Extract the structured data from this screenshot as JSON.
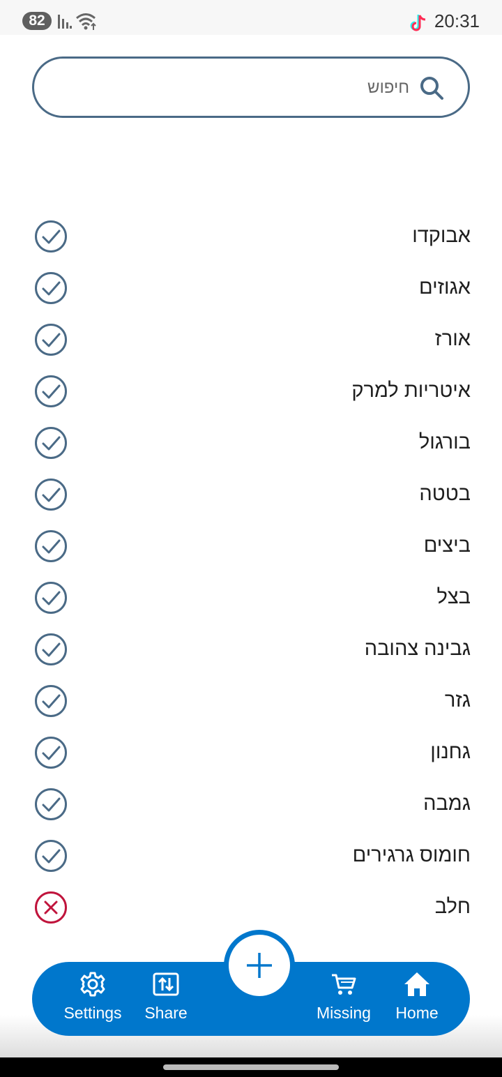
{
  "status_bar": {
    "battery": "82",
    "time": "20:31"
  },
  "search": {
    "placeholder": "חיפוש",
    "value": ""
  },
  "items": [
    {
      "label": "אבוקדו",
      "status": "check"
    },
    {
      "label": "אגוזים",
      "status": "check"
    },
    {
      "label": "אורז",
      "status": "check"
    },
    {
      "label": "איטריות למרק",
      "status": "check"
    },
    {
      "label": "בורגול",
      "status": "check"
    },
    {
      "label": "בטטה",
      "status": "check"
    },
    {
      "label": "ביצים",
      "status": "check"
    },
    {
      "label": "בצל",
      "status": "check"
    },
    {
      "label": "גבינה צהובה",
      "status": "check"
    },
    {
      "label": "גזר",
      "status": "check"
    },
    {
      "label": "גחנון",
      "status": "check"
    },
    {
      "label": "גמבה",
      "status": "check"
    },
    {
      "label": "חומוס גרגירים",
      "status": "check"
    },
    {
      "label": "חלב",
      "status": "cross"
    }
  ],
  "bottom_nav": {
    "settings_label": "Settings",
    "share_label": "Share",
    "missing_label": "Missing",
    "home_label": "Home"
  },
  "icons": {
    "check": "check-circle-icon",
    "cross": "x-circle-icon",
    "fab": "plus-icon"
  },
  "colors": {
    "accent": "#0077cc",
    "check": "#4a6a86",
    "cross": "#c0143c",
    "text": "#1e1e1e"
  }
}
